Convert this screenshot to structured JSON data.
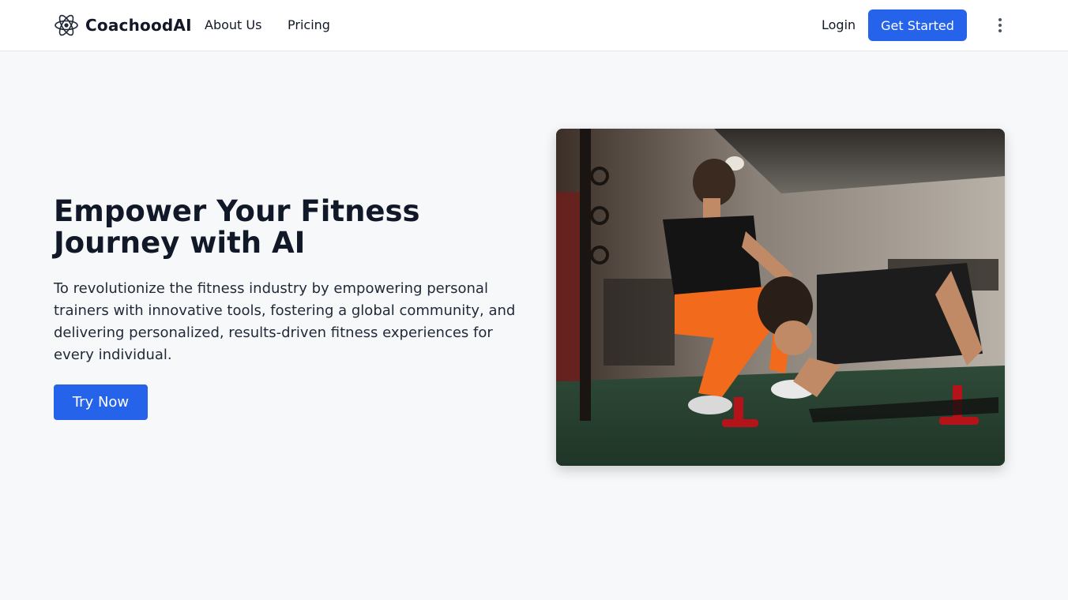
{
  "nav": {
    "brand": "CoachoodAI",
    "links": [
      "About Us",
      "Pricing"
    ],
    "login": "Login",
    "get_started": "Get Started",
    "menu_icon": "more-vertical-icon"
  },
  "hero": {
    "title": "Empower Your Fitness Journey with AI",
    "description": "To revolutionize the fitness industry by empowering personal trainers with innovative tools, fostering a global community, and delivering personalized, results-driven fitness experiences for every individual.",
    "cta": "Try Now"
  },
  "colors": {
    "accent": "#2563eb",
    "background": "#f7f8fa",
    "text": "#111827"
  }
}
